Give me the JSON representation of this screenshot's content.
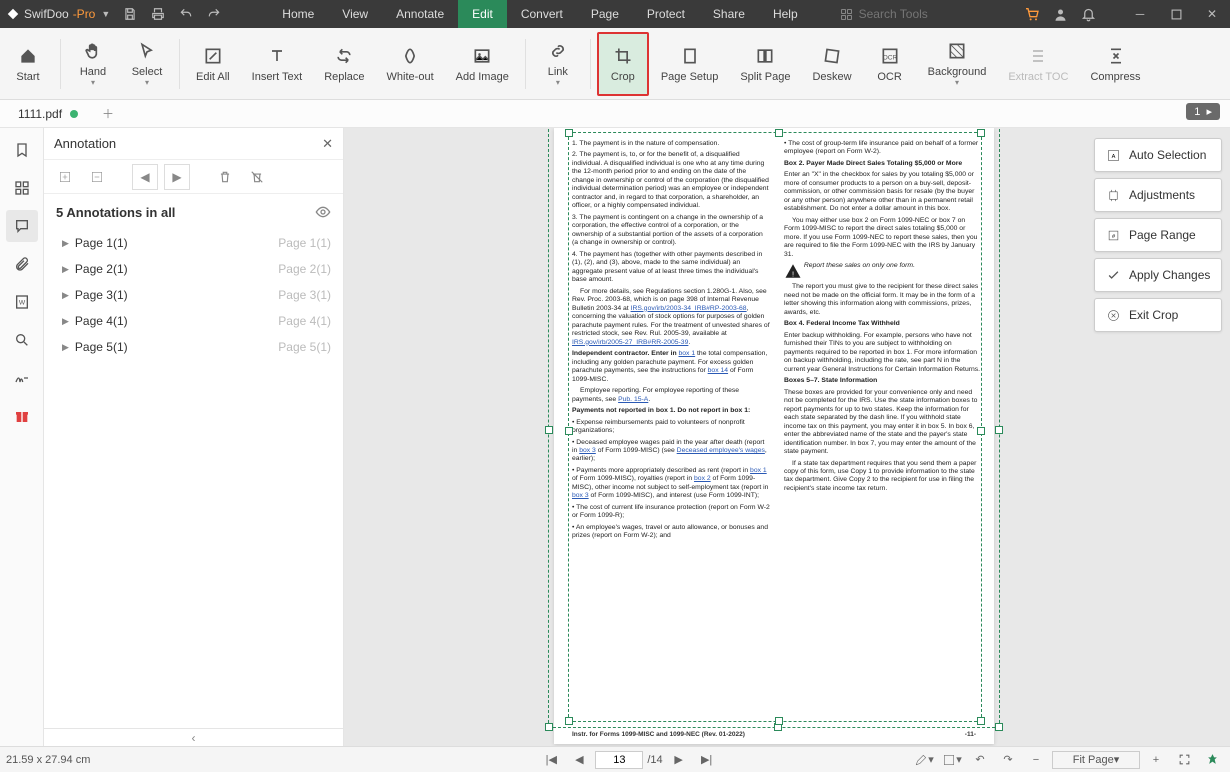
{
  "brand": {
    "name": "SwifDoo",
    "suffix": "-Pro"
  },
  "menu": [
    "Home",
    "View",
    "Annotate",
    "Edit",
    "Convert",
    "Page",
    "Protect",
    "Share",
    "Help"
  ],
  "menu_active": 3,
  "search_placeholder": "Search Tools",
  "ribbon": [
    {
      "label": "Start",
      "icon": "home"
    },
    {
      "label": "Hand",
      "icon": "hand",
      "caret": true
    },
    {
      "label": "Select",
      "icon": "cursor",
      "caret": true
    },
    {
      "label": "Edit All",
      "icon": "edit"
    },
    {
      "label": "Insert Text",
      "icon": "text"
    },
    {
      "label": "Replace",
      "icon": "replace"
    },
    {
      "label": "White-out",
      "icon": "eraser"
    },
    {
      "label": "Add Image",
      "icon": "image"
    },
    {
      "label": "Link",
      "icon": "link",
      "caret": true
    },
    {
      "label": "Crop",
      "icon": "crop",
      "highlighted": true
    },
    {
      "label": "Page Setup",
      "icon": "pagesetup"
    },
    {
      "label": "Split Page",
      "icon": "split"
    },
    {
      "label": "Deskew",
      "icon": "deskew"
    },
    {
      "label": "OCR",
      "icon": "ocr"
    },
    {
      "label": "Background",
      "icon": "bg",
      "caret": true
    },
    {
      "label": "Extract TOC",
      "icon": "toc",
      "disabled": true
    },
    {
      "label": "Compress",
      "icon": "compress"
    }
  ],
  "file_tab": "1111.pdf",
  "page_pill": "1",
  "panel": {
    "title": "Annotation",
    "count_label": "5 Annotations in all",
    "rows": [
      {
        "l": "Page 1(1)",
        "r": "Page 1(1)"
      },
      {
        "l": "Page 2(1)",
        "r": "Page 2(1)"
      },
      {
        "l": "Page 3(1)",
        "r": "Page 3(1)"
      },
      {
        "l": "Page 4(1)",
        "r": "Page 4(1)"
      },
      {
        "l": "Page 5(1)",
        "r": "Page 5(1)"
      }
    ]
  },
  "crop_actions": [
    "Auto Selection",
    "Adjustments",
    "Page Range",
    "Apply Changes",
    "Exit Crop"
  ],
  "doc": {
    "left": [
      "1.   The payment is in the nature of compensation.",
      "2.   The payment is, to, or for the benefit of, a disqualified individual. A disqualified individual is one who at any time during the 12-month period prior to and ending on the date of the change in ownership or control of the corporation (the disqualified individual determination period) was an employee or independent contractor and, in regard to that corporation, a shareholder, an officer, or a highly compensated individual.",
      "3.   The payment is contingent on a change in the ownership of a corporation, the effective control of a corporation, or the ownership of a substantial portion of the assets of a corporation (a change in ownership or control).",
      "4.   The payment has (together with other payments described in (1), (2), and (3), above, made to the same individual) an aggregate present value of at least three times the individual's base amount.",
      "For more details, see Regulations section 1.280G-1. Also, see Rev. Proc. 2003-68, which is on page 398 of Internal Revenue Bulletin 2003-34 at",
      "Employee reporting. For employee reporting of these payments, see",
      "Payments not reported in box 1.  Do not report in box 1:",
      "• Expense reimbursements paid to volunteers of nonprofit organizations;",
      "• Deceased employee wages paid in the year after death (report in box 3 of Form 1099-MISC) (see Deceased employee's wages, earlier);",
      "• Payments more appropriately described as rent (report in box 1 of Form 1099-MISC), royalties (report in box 2 of Form 1099-MISC), other income not subject to self-employment tax (report in box 3 of Form 1099-MISC), and interest (use Form 1099-INT);",
      "• The cost of current life insurance protection (report on Form W-2 or Form 1099-R);",
      "• An employee's wages, travel or auto allowance, or bonuses and prizes (report on Form W-2); and"
    ],
    "left_links": {
      "a": "IRS.gov/irb/2003-34_IRB#RP-2003-68",
      "b": "IRS.gov/irb/2005-27_IRB#RR-2005-39",
      "c": "box 1",
      "d": "box 14",
      "e": "Pub. 15-A",
      "f": "box 3",
      "g": "Deceased employee's wages",
      "h": "box 1",
      "i": "box 2",
      "j": "box 3"
    },
    "left_independent": "Independent contractor.   Enter in ",
    "left_independent2": " the total compensation, including any golden parachute payment. For excess golden parachute payments, see the instructions for ",
    "left_independent3": " of Form 1099-MISC.",
    "right": [
      "• The cost of group-term life insurance paid on behalf of a former employee (report on Form W-2).",
      "Box 2. Payer Made Direct Sales Totaling $5,000 or More",
      "Enter an \"X\" in the checkbox for sales by you totaling $5,000 or more of consumer products to a person on a buy-sell, deposit-commission, or other commission basis for resale (by the buyer or any other person) anywhere other than in a permanent retail establishment. Do not enter a dollar amount in this box.",
      "You may either use box 2 on Form 1099-NEC or box 7 on Form 1099-MISC to report the direct sales totaling $5,000 or more. If you use Form 1099-NEC to report these sales, then you are required to file the Form 1099-NEC with the IRS by January 31.",
      "Report these sales on only one form.",
      "The report you must give to the recipient for these direct sales need not be made on the official form. It may be in the form of a letter showing this information along with commissions, prizes, awards, etc.",
      "Box 4. Federal Income Tax Withheld",
      "Enter backup withholding. For example, persons who have not furnished their TINs to you are subject to withholding on payments required to be reported in box 1. For more information on backup withholding, including the rate, see part N in the current year General Instructions for Certain Information Returns.",
      "Boxes 5–7. State Information",
      "These boxes are provided for your convenience only and need not be completed for the IRS. Use the state information boxes to report payments for up to two states. Keep the information for each state separated by the dash line. If you withhold state income tax on this payment, you may enter it in box 5. In box 6, enter the abbreviated name of the state and the payer's state identification number. In box 7, you may enter the amount of the state payment.",
      "If a state tax department requires that you send them a paper copy of this form, use Copy 1 to provide information to the state tax department. Give Copy 2 to the recipient for use in filing the recipient's state income tax return."
    ],
    "footer_left": "Instr. for Forms 1099-MISC and 1099-NEC (Rev. 01-2022)",
    "footer_right": "-11-"
  },
  "status": {
    "dims": "21.59 x 27.94 cm",
    "page": "13",
    "total": "/14",
    "zoom": "Fit Page"
  }
}
